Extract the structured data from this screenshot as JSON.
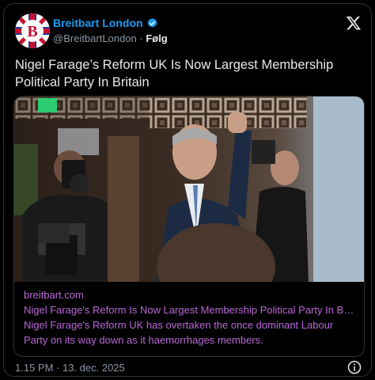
{
  "account": {
    "name": "Breitbart London",
    "handle": "@BreitbartLondon",
    "separator": "·",
    "follow_label": "Følg"
  },
  "tweet": {
    "headline": "Nigel Farage’s Reform UK Is Now Largest Membership Political Party In Britain"
  },
  "card": {
    "domain": "breitbart.com",
    "title": "Nigel Farage's Reform Is Now Largest Membership Political Party In Bri…",
    "description": "Nigel Farage's Reform UK has overtaken the once dominant Labour Party on its way down as it haemorrhages members."
  },
  "footer": {
    "timestamp": "1.15 PM · 13. dec. 2025"
  },
  "colors": {
    "name_blue": "#1d9bf0",
    "card_link_purple": "#b967d6",
    "muted": "#8b98a5"
  },
  "icons": {
    "verified": "verified-badge-icon",
    "x": "x-logo-icon",
    "info": "info-icon"
  }
}
